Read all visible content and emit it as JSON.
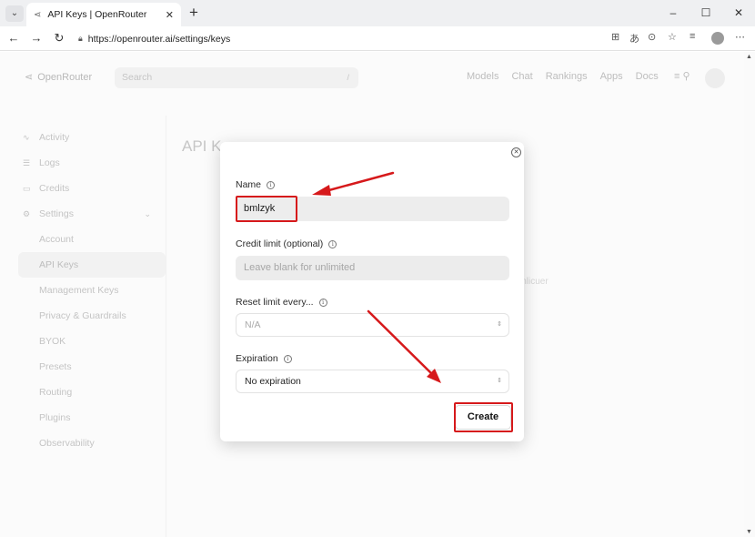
{
  "browser": {
    "tab_title": "API Keys | OpenRouter",
    "tab_close": "✕",
    "new_tab": "+",
    "url": "https://openrouter.ai/settings/keys",
    "window_controls": [
      "–",
      "☐",
      "✕"
    ]
  },
  "site": {
    "logo_text": "OpenRouter",
    "search_placeholder": "Search",
    "search_shortcut": "/",
    "nav": [
      "Models",
      "Chat",
      "Rankings",
      "Apps",
      "Docs"
    ]
  },
  "sidebar": {
    "items": [
      {
        "label": "Activity",
        "icon": "activity-icon"
      },
      {
        "label": "Logs",
        "icon": "list-icon"
      },
      {
        "label": "Credits",
        "icon": "card-icon"
      },
      {
        "label": "Settings",
        "icon": "gear-icon"
      }
    ],
    "sub_items": [
      "Account",
      "API Keys",
      "Management Keys",
      "Privacy & Guardrails",
      "BYOK",
      "Presets",
      "Routing",
      "Plugins",
      "Observability"
    ]
  },
  "main": {
    "title": "API Keys",
    "ghost_text": "Unlicuer"
  },
  "modal": {
    "name_label": "Name",
    "name_value": "bmlzyk",
    "credit_label": "Credit limit (optional)",
    "credit_placeholder": "Leave blank for unlimited",
    "reset_label": "Reset limit every...",
    "reset_value": "N/A",
    "expiration_label": "Expiration",
    "expiration_value": "No expiration",
    "create_label": "Create"
  },
  "annotations": {
    "highlight_color": "#d6191b",
    "highlighted": [
      "name-input",
      "create-button"
    ]
  }
}
